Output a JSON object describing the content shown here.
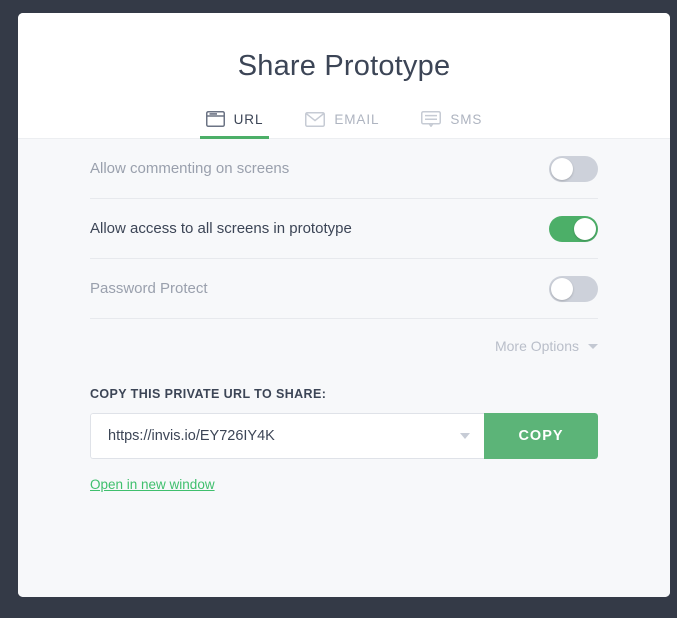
{
  "window": {
    "backdrop_color": "#343a47",
    "card_background": "#ffffff",
    "body_background": "#f7f8fa"
  },
  "header": {
    "title": "Share Prototype",
    "tabs": [
      {
        "label": "URL",
        "icon": "browser-window-icon",
        "active": true
      },
      {
        "label": "EMAIL",
        "icon": "envelope-icon",
        "active": false
      },
      {
        "label": "SMS",
        "icon": "speech-bubble-icon",
        "active": false
      }
    ],
    "active_tab_accent": "#4caf68"
  },
  "options": [
    {
      "label": "Allow commenting on screens",
      "state": "off"
    },
    {
      "label": "Allow access to all screens in prototype",
      "state": "on"
    },
    {
      "label": "Password Protect",
      "state": "off"
    }
  ],
  "more_options": {
    "label": "More Options",
    "icon": "chevron-down-icon"
  },
  "url_section": {
    "section_label": "COPY THIS PRIVATE URL TO SHARE:",
    "url_value": "https://invis.io/EY726IY4K",
    "url_placeholder": "https://invis.io/",
    "dropdown_icon": "chevron-down-icon",
    "copy_label": "COPY",
    "copy_color": "#5cb478",
    "open_link_label": "Open in new window",
    "link_color": "#3fbf6d"
  }
}
